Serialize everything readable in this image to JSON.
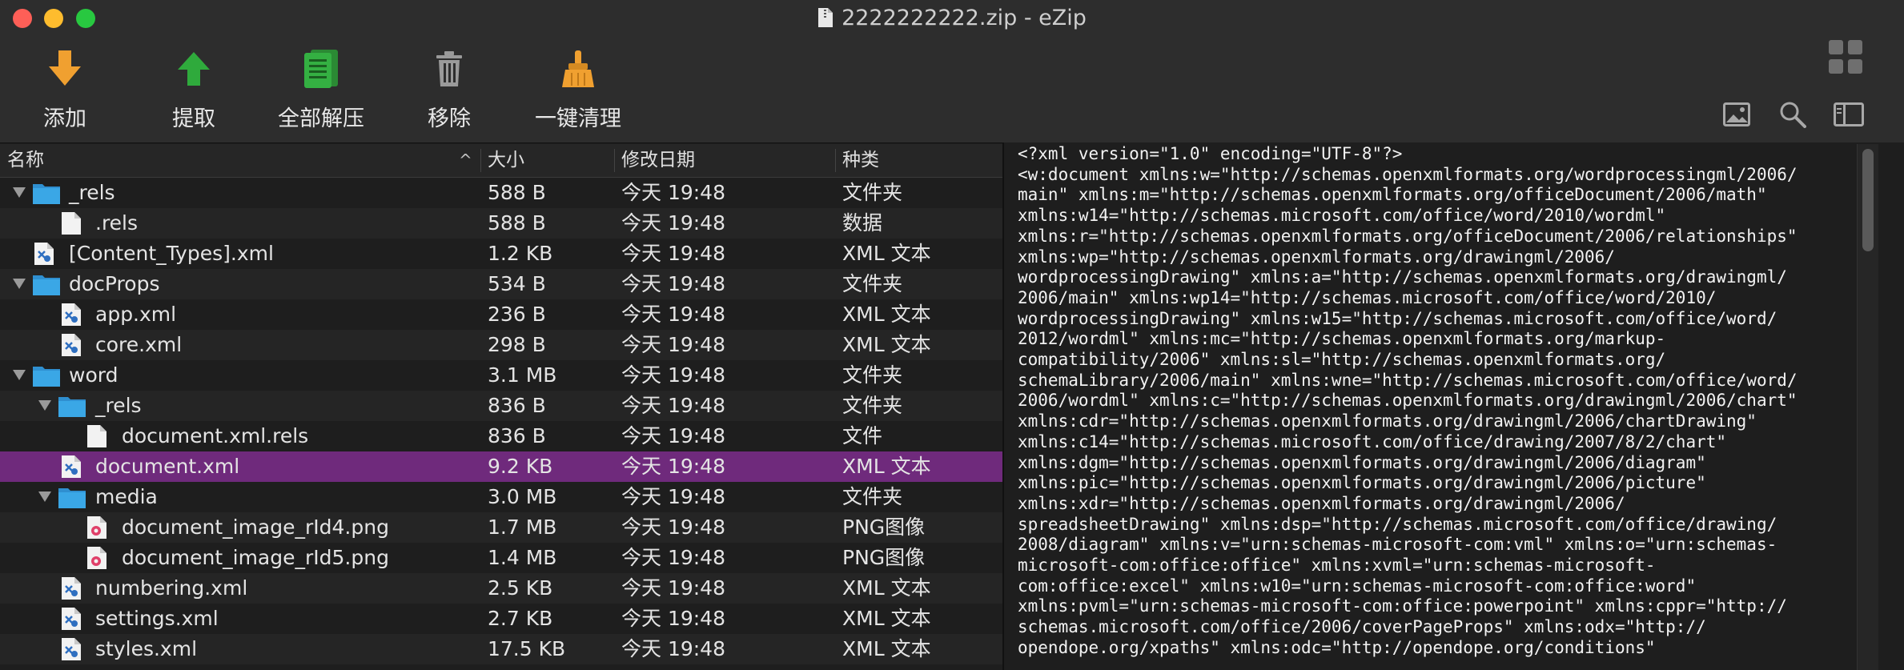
{
  "window": {
    "title": "2222222222.zip - eZip"
  },
  "toolbar": {
    "add": "添加",
    "extract": "提取",
    "extract_all": "全部解压",
    "remove": "移除",
    "clean": "一键清理"
  },
  "columns": {
    "name": "名称",
    "size": "大小",
    "modified": "修改日期",
    "kind": "种类"
  },
  "files": [
    {
      "name": "_rels",
      "size": "588 B",
      "date": "今天 19:48",
      "kind": "文件夹"
    },
    {
      "name": ".rels",
      "size": "588 B",
      "date": "今天 19:48",
      "kind": "数据"
    },
    {
      "name": "[Content_Types].xml",
      "size": "1.2 KB",
      "date": "今天 19:48",
      "kind": "XML 文本"
    },
    {
      "name": "docProps",
      "size": "534 B",
      "date": "今天 19:48",
      "kind": "文件夹"
    },
    {
      "name": "app.xml",
      "size": "236 B",
      "date": "今天 19:48",
      "kind": "XML 文本"
    },
    {
      "name": "core.xml",
      "size": "298 B",
      "date": "今天 19:48",
      "kind": "XML 文本"
    },
    {
      "name": "word",
      "size": "3.1 MB",
      "date": "今天 19:48",
      "kind": "文件夹"
    },
    {
      "name": "_rels",
      "size": "836 B",
      "date": "今天 19:48",
      "kind": "文件夹"
    },
    {
      "name": "document.xml.rels",
      "size": "836 B",
      "date": "今天 19:48",
      "kind": "文件"
    },
    {
      "name": "document.xml",
      "size": "9.2 KB",
      "date": "今天 19:48",
      "kind": "XML 文本"
    },
    {
      "name": "media",
      "size": "3.0 MB",
      "date": "今天 19:48",
      "kind": "文件夹"
    },
    {
      "name": "document_image_rId4.png",
      "size": "1.7 MB",
      "date": "今天 19:48",
      "kind": "PNG图像"
    },
    {
      "name": "document_image_rId5.png",
      "size": "1.4 MB",
      "date": "今天 19:48",
      "kind": "PNG图像"
    },
    {
      "name": "numbering.xml",
      "size": "2.5 KB",
      "date": "今天 19:48",
      "kind": "XML 文本"
    },
    {
      "name": "settings.xml",
      "size": "2.7 KB",
      "date": "今天 19:48",
      "kind": "XML 文本"
    },
    {
      "name": "styles.xml",
      "size": "17.5 KB",
      "date": "今天 19:48",
      "kind": "XML 文本"
    }
  ],
  "preview_text": "<?xml version=\"1.0\" encoding=\"UTF-8\"?>\n<w:document xmlns:w=\"http://schemas.openxmlformats.org/wordprocessingml/2006/\nmain\" xmlns:m=\"http://schemas.openxmlformats.org/officeDocument/2006/math\"\nxmlns:w14=\"http://schemas.microsoft.com/office/word/2010/wordml\"\nxmlns:r=\"http://schemas.openxmlformats.org/officeDocument/2006/relationships\"\nxmlns:wp=\"http://schemas.openxmlformats.org/drawingml/2006/\nwordprocessingDrawing\" xmlns:a=\"http://schemas.openxmlformats.org/drawingml/\n2006/main\" xmlns:wp14=\"http://schemas.microsoft.com/office/word/2010/\nwordprocessingDrawing\" xmlns:w15=\"http://schemas.microsoft.com/office/word/\n2012/wordml\" xmlns:mc=\"http://schemas.openxmlformats.org/markup-\ncompatibility/2006\" xmlns:sl=\"http://schemas.openxmlformats.org/\nschemaLibrary/2006/main\" xmlns:wne=\"http://schemas.microsoft.com/office/word/\n2006/wordml\" xmlns:c=\"http://schemas.openxmlformats.org/drawingml/2006/chart\"\nxmlns:cdr=\"http://schemas.openxmlformats.org/drawingml/2006/chartDrawing\"\nxmlns:c14=\"http://schemas.microsoft.com/office/drawing/2007/8/2/chart\"\nxmlns:dgm=\"http://schemas.openxmlformats.org/drawingml/2006/diagram\"\nxmlns:pic=\"http://schemas.openxmlformats.org/drawingml/2006/picture\"\nxmlns:xdr=\"http://schemas.openxmlformats.org/drawingml/2006/\nspreadsheetDrawing\" xmlns:dsp=\"http://schemas.microsoft.com/office/drawing/\n2008/diagram\" xmlns:v=\"urn:schemas-microsoft-com:vml\" xmlns:o=\"urn:schemas-\nmicrosoft-com:office:office\" xmlns:xvml=\"urn:schemas-microsoft-\ncom:office:excel\" xmlns:w10=\"urn:schemas-microsoft-com:office:word\"\nxmlns:pvml=\"urn:schemas-microsoft-com:office:powerpoint\" xmlns:cppr=\"http://\nschemas.microsoft.com/office/2006/coverPageProps\" xmlns:odx=\"http://\nopendope.org/xpaths\" xmlns:odc=\"http://opendope.org/conditions\"",
  "colors": {
    "selection": "#6f2a7c",
    "folder": "#3aa7e6",
    "accent_orange": "#f0a030",
    "accent_green": "#2faa3c"
  }
}
